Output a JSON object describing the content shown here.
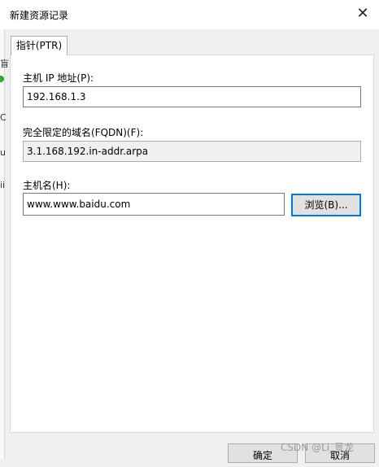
{
  "window": {
    "title": "新建资源记录",
    "close_glyph": "✕"
  },
  "tabs": [
    {
      "label": "指针(PTR)"
    }
  ],
  "form": {
    "host_ip_label": "主机 IP 地址(P):",
    "host_ip_value": "192.168.1.3",
    "fqdn_label": "完全限定的域名(FQDN)(F):",
    "fqdn_value": "3.1.168.192.in-addr.arpa",
    "host_name_label": "主机名(H):",
    "host_name_value": "www.www.baidu.com",
    "browse_label": "浏览(B)..."
  },
  "footer": {
    "ok_label": "确定",
    "cancel_label": "取消"
  },
  "background_window": {
    "fragments": [
      "盲",
      "C",
      "u",
      "ii"
    ]
  },
  "watermark": "CSDN @Li_景龙",
  "colors": {
    "focus_border": "#0078d7",
    "button_face": "#e1e1e1"
  }
}
